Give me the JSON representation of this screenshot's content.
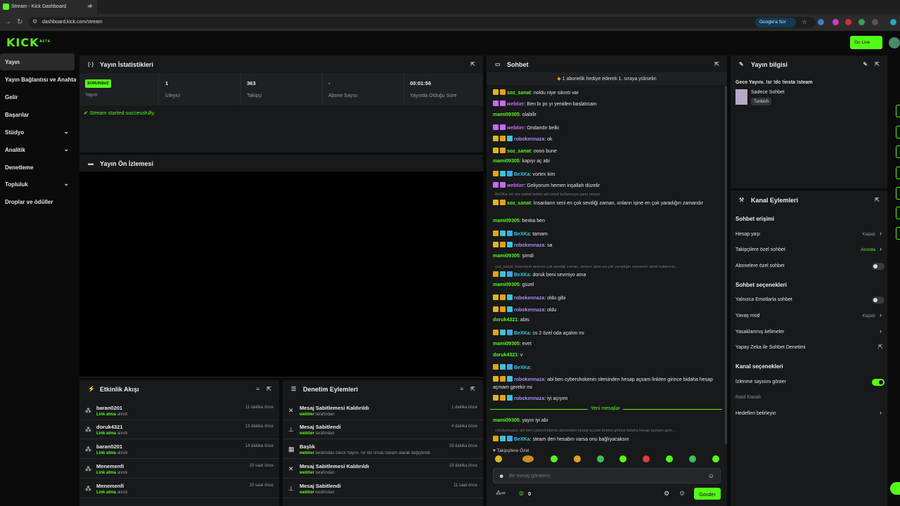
{
  "browser": {
    "tab_title": "Stream - Kick Dashboard",
    "url": "dashboard.kick.com/stream",
    "google_search_label": "Google'a Sor"
  },
  "app": {
    "logo": "KICK",
    "logo_sup": "BETA",
    "go_live_label": "Go Live",
    "accent": "#53fc18"
  },
  "sidebar": {
    "items": [
      {
        "label": "Yayın",
        "active": true
      },
      {
        "label": "Yayın Bağlantısı ve Anahtarı"
      },
      {
        "label": "Gelir"
      },
      {
        "label": "Başarılar"
      },
      {
        "label": "Stüdyo",
        "expandable": true
      },
      {
        "label": "Analitik",
        "expandable": true
      },
      {
        "label": "Denetleme"
      },
      {
        "label": "Topluluk",
        "expandable": true
      },
      {
        "label": "Droplar ve ödüller"
      }
    ]
  },
  "stats_panel": {
    "title": "Yayın İstatistikleri",
    "badge": "SORUNSUZ",
    "badge_label": "Yayın",
    "stats": [
      {
        "value": "1",
        "label": "İzleyici"
      },
      {
        "value": "363",
        "label": "Takipçi"
      },
      {
        "value": "-",
        "label": "Abone Sayısı"
      },
      {
        "value": "00:01:56",
        "label": "Yayında Olduğu Süre"
      }
    ],
    "success_message": "Stream started successfully."
  },
  "preview_panel": {
    "title": "Yayın Ön İzlemesi"
  },
  "activity_panel": {
    "title": "Etkinlik Akışı",
    "items": [
      {
        "name": "baran0201",
        "action": "Link atma",
        "suffix": "alındı",
        "time": "11 dakika önce"
      },
      {
        "name": "doruk4321",
        "action": "Link atma",
        "suffix": "alındı",
        "time": "13 dakika önce"
      },
      {
        "name": "baran0201",
        "action": "Link atma",
        "suffix": "alındı",
        "time": "14 dakika önce"
      },
      {
        "name": "Menemenfi",
        "action": "Link atma",
        "suffix": "alındı",
        "time": "20 saat önce"
      },
      {
        "name": "Menemenfi",
        "action": "Link atma",
        "suffix": "alındı",
        "time": "20 saat önce"
      }
    ]
  },
  "moderation_panel": {
    "title": "Denetim Eylemleri",
    "items": [
      {
        "name": "Mesaj Sabitlemesi Kaldırıldı",
        "by": "webtier",
        "suffix": "tarafından",
        "time": "1 dakika önce",
        "icon": "unpin-icon"
      },
      {
        "name": "Mesaj Sabitlendi",
        "by": "webtier",
        "suffix": "tarafından",
        "time": "4 dakika önce",
        "icon": "pin-icon"
      },
      {
        "name": "Başlık",
        "by": "webtier",
        "suffix": "tarafından Gece Yayını. !sr !dc !insta !steam olarak değiştirildi",
        "time": "19 dakika önce",
        "icon": "title-icon"
      },
      {
        "name": "Mesaj Sabitlemesi Kaldırıldı",
        "by": "webtier",
        "suffix": "tarafından",
        "time": "19 dakika önce",
        "icon": "unpin-icon"
      },
      {
        "name": "Mesaj Sabitlendi",
        "by": "webtier",
        "suffix": "tarafından",
        "time": "11 saat önce",
        "icon": "pin-icon"
      }
    ]
  },
  "chat": {
    "title": "Sohbet",
    "pinned": "1 abonelik hediye ederek 1. sıraya yükselin",
    "messages": [
      {
        "user": "soz_sanat",
        "color": "#53fc18",
        "badges": [
          "#d9b826",
          "#e6a01a"
        ],
        "text": "noldu niye sıkıntı var"
      },
      {
        "user": "webtier",
        "color": "#c86bf2",
        "badges": [
          "#c86bf2",
          "#c86bf2"
        ],
        "text": "Ben bı pc yı yeniden baslatıcam"
      },
      {
        "user": "mami09305",
        "color": "#53fc18",
        "badges": [],
        "text": "olabilir"
      },
      {
        "user": "webtier",
        "color": "#c86bf2",
        "badges": [
          "#c86bf2",
          "#c86bf2"
        ],
        "text": "Ondandır belki"
      },
      {
        "user": "robokennaza",
        "color": "#a98cf5",
        "badges": [
          "#d9b826",
          "#e6a01a",
          "#3ac6d6"
        ],
        "text": "ok"
      },
      {
        "user": "soz_sanat",
        "color": "#53fc18",
        "badges": [
          "#d9b826",
          "#e6a01a"
        ],
        "text": "oooo bune"
      },
      {
        "user": "mami09305",
        "color": "#53fc18",
        "badges": [],
        "text": "kapıyı aç abi"
      },
      {
        "user": "BeXKa",
        "color": "#3ac6d6",
        "badges": [
          "#e6a01a",
          "#3ac6d6",
          "#3aa7e6"
        ],
        "text": "vortex kim"
      },
      {
        "user": "webtier",
        "color": "#c86bf2",
        "badges": [
          "#c86bf2",
          "#c86bf2"
        ],
        "text": "Geliyorum hemen inşallah düzelir"
      },
      {
        "user": "soz_sanat",
        "color": "#53fc18",
        "badges": [
          "#d9b826",
          "#e6a01a"
        ],
        "text": "İnsanların seni en çok sevdiği zaman, onların işine en çok yaradığın zamandır",
        "reply": "BeXKa: bir söz pattat bakim abi istedi kullanıcıya yanıt veriyor"
      },
      {
        "user": "mami09305",
        "color": "#53fc18",
        "badges": [],
        "text": "bexka ben"
      },
      {
        "user": "BeXKa",
        "color": "#3ac6d6",
        "badges": [
          "#e6a01a",
          "#3ac6d6",
          "#3aa7e6"
        ],
        "text": "tamam"
      },
      {
        "user": "robokennaza",
        "color": "#a98cf5",
        "badges": [
          "#d9b826",
          "#e6a01a",
          "#3ac6d6"
        ],
        "text": "sa"
      },
      {
        "user": "mami09305",
        "color": "#53fc18",
        "badges": [],
        "text": "şimdi"
      },
      {
        "user": "BeXKa",
        "color": "#3ac6d6",
        "badges": [
          "#e6a01a",
          "#3ac6d6",
          "#3aa7e6"
        ],
        "text": "doruk beni sevmiyo ama",
        "reply": "soz_sanat: İnsanların seni en çok sevdiği zaman, onların işine en çok yaradığın zamandır isimli kullanıcıy..."
      },
      {
        "user": "mami09305",
        "color": "#53fc18",
        "badges": [],
        "text": "güzel"
      },
      {
        "user": "robokennaza",
        "color": "#a98cf5",
        "badges": [
          "#d9b826",
          "#e6a01a",
          "#3ac6d6"
        ],
        "text": "oldu gibi"
      },
      {
        "user": "robokennaza",
        "color": "#a98cf5",
        "badges": [
          "#d9b826",
          "#e6a01a",
          "#3ac6d6"
        ],
        "text": "oldu"
      },
      {
        "user": "doruk4321",
        "color": "#53fc18",
        "badges": [],
        "text": "abis"
      },
      {
        "user": "BeXKa",
        "color": "#3ac6d6",
        "badges": [
          "#e6a01a",
          "#3ac6d6",
          "#3aa7e6"
        ],
        "text": "cs 2 özel oda açalım mı"
      },
      {
        "user": "mami09305",
        "color": "#53fc18",
        "badges": [],
        "text": "evet"
      },
      {
        "user": "doruk4321",
        "color": "#53fc18",
        "badges": [],
        "text": "v"
      },
      {
        "user": "BeXKa",
        "color": "#3ac6d6",
        "badges": [
          "#e6a01a",
          "#3ac6d6",
          "#3aa7e6"
        ],
        "text": ""
      },
      {
        "user": "robokennaza",
        "color": "#a98cf5",
        "badges": [
          "#d9b826",
          "#e6a01a",
          "#3ac6d6"
        ],
        "text": "abi ben cybershokenin sitesinden hesap açsam linkten girince bidaha hesap açmam gerekir mi"
      },
      {
        "user": "robokennaza",
        "color": "#a98cf5",
        "badges": [
          "#d9b826",
          "#e6a01a",
          "#3ac6d6"
        ],
        "text": "iyi açıyım"
      }
    ],
    "new_messages_label": "Yeni mesajlar",
    "new_messages": [
      {
        "user": "mami09305",
        "color": "#53fc18",
        "badges": [],
        "text": "yayın iyi abi"
      },
      {
        "user": "BeXKa",
        "color": "#3ac6d6",
        "badges": [
          "#e6a01a",
          "#3ac6d6",
          "#3aa7e6"
        ],
        "text": "steam den hesabın varsa onu bağlıyacaksın",
        "reply": "robokennaza: abi ben cybershokenin sitesinden hesap açsam linkten girince bidaha hesap açmam gere..."
      }
    ],
    "followers_only_label": "Takipçilere Özel",
    "input_placeholder": "Bir mesaj gönderin",
    "points_value": "0",
    "send_label": "Gönder"
  },
  "stream_info": {
    "title": "Yayın bilgisi",
    "stream_title": "Gece Yayını. !sr !dc !insta !steam",
    "category": "Sadece Sohbet",
    "language": "Turkish"
  },
  "channel_actions": {
    "title": "Kanal Eylemleri",
    "chat_access_heading": "Sohbet erişimi",
    "account_age_label": "Hesap yaşı",
    "account_age_value": "Kapalı",
    "followers_only_label": "Takipçilere özel sohbet",
    "followers_only_value": "Anında",
    "subscribers_only_label": "Abonelere özel sohbet",
    "subscribers_only_on": false,
    "chat_options_heading": "Sohbet seçenekleri",
    "emotes_only_label": "Yalnızca Emotlarla sohbet",
    "emotes_only_on": false,
    "slow_mode_label": "Yavaş mod",
    "slow_mode_value": "Kapalı",
    "banned_words_label": "Yasaklanmış kelimeler",
    "ai_moderation_label": "Yapay Zeka ile Sohbet Denetimi",
    "channel_options_heading": "Kanal seçenekleri",
    "show_viewers_label": "İzlenme sayısını göster",
    "show_viewers_on": true,
    "raid_label": "Raid Kanalı",
    "goals_label": "Hedefleri belirleyin"
  }
}
